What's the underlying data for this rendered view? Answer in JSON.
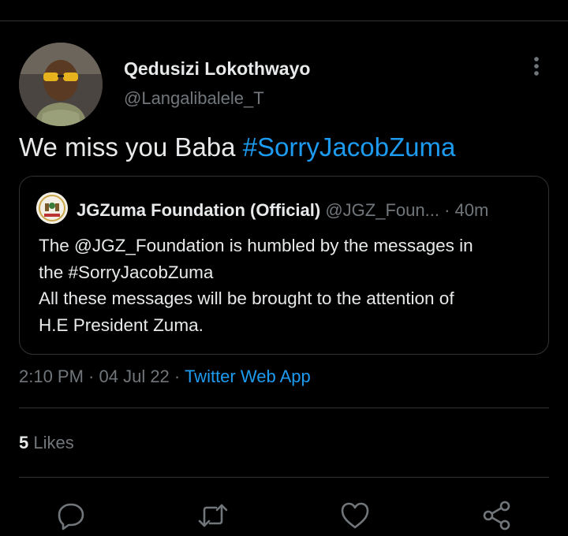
{
  "tweet": {
    "author_name": "Qedusizi Lokothwayo",
    "author_handle": "@Langalibalele_T",
    "text": "We miss you Baba ",
    "hashtag": "#SorryJacobZuma"
  },
  "quoted_tweet": {
    "author_name": "JGZuma Foundation (Official)",
    "author_handle": "@JGZ_Foun...",
    "separator": " · ",
    "time": "40m",
    "lines": [
      "The @JGZ_Foundation is humbled by the messages in",
      "the #SorryJacobZuma",
      "All these messages will be brought to the attention of",
      "H.E President Zuma."
    ]
  },
  "meta": {
    "time": "2:10 PM",
    "separator": " · ",
    "date": "04 Jul 22",
    "source": "Twitter Web App"
  },
  "engagement": {
    "likes_count": "5",
    "likes_label": " Likes"
  },
  "actions": [
    "reply-icon",
    "retweet-icon",
    "like-icon",
    "share-icon"
  ],
  "colors": {
    "background": "#000000",
    "text": "#e7e9ea",
    "secondary": "#71767b",
    "accent": "#1d9bf0",
    "border": "#2f3336"
  }
}
